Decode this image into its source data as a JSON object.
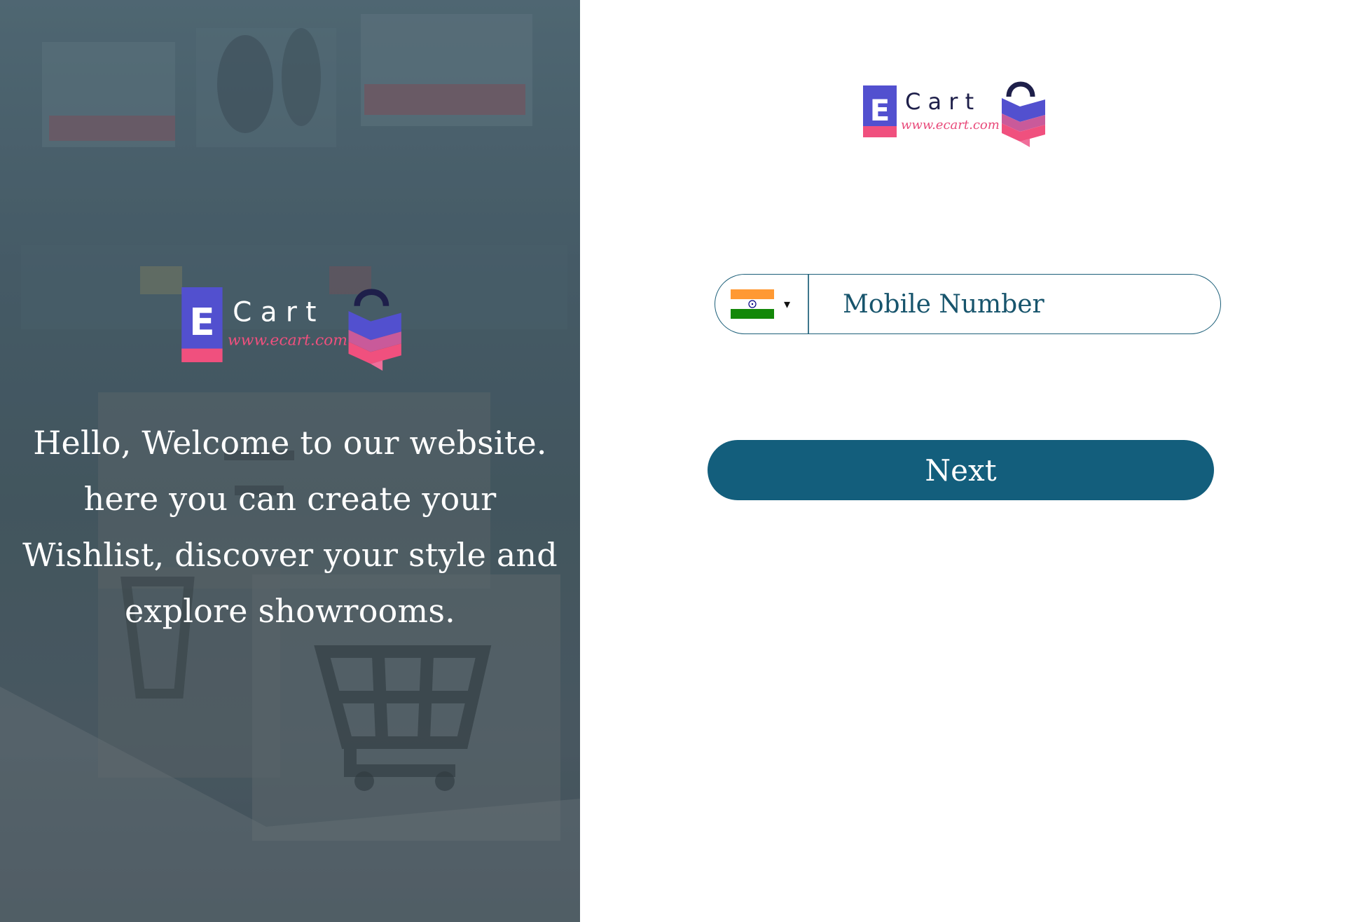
{
  "brand": {
    "letter": "E",
    "name": "C a r t",
    "url": "www.ecart.com"
  },
  "welcome": {
    "text": "Hello, Welcome to our website. here you can create your Wishlist, discover your style and explore showrooms."
  },
  "phone_field": {
    "country_code": "IN",
    "flag_icon": "india-flag-icon",
    "caret_icon": "caret-down-icon",
    "caret_glyph": "▾",
    "placeholder": "Mobile Number",
    "value": ""
  },
  "next_button": {
    "label": "Next"
  },
  "colors": {
    "primary": "#135e7c",
    "brand_blue": "#5250cf",
    "brand_pink": "#f0507e",
    "brand_navy": "#1e1f4a"
  }
}
